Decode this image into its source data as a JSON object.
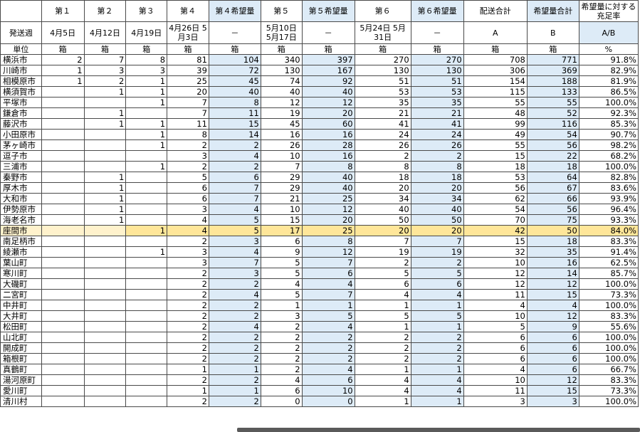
{
  "header_row1": [
    "",
    "第１",
    "第２",
    "第３",
    "第４",
    "第４希望量",
    "第５",
    "第５希望量",
    "第６",
    "第６希望量",
    "配送合計",
    "希望量合計",
    "希望量に対する充足率"
  ],
  "header_row2": [
    "発送週",
    "4月5日",
    "4月12日",
    "4月19日",
    "4月26日\n5月3日",
    "－",
    "5月10日\n5月17日",
    "－",
    "5月24日\n5月31日",
    "－",
    "A",
    "B",
    "A/B"
  ],
  "header_row3": [
    "単位",
    "箱",
    "箱",
    "箱",
    "箱",
    "箱",
    "箱",
    "箱",
    "箱",
    "箱",
    "箱",
    "箱",
    "%"
  ],
  "rows": [
    [
      "横浜市",
      "2",
      "7",
      "8",
      "81",
      "104",
      "340",
      "397",
      "270",
      "270",
      "708",
      "771",
      "91.8%"
    ],
    [
      "川崎市",
      "1",
      "3",
      "3",
      "39",
      "72",
      "130",
      "167",
      "130",
      "130",
      "306",
      "369",
      "82.9%"
    ],
    [
      "相模原市",
      "1",
      "2",
      "1",
      "25",
      "45",
      "74",
      "92",
      "51",
      "51",
      "154",
      "188",
      "81.9%"
    ],
    [
      "横須賀市",
      "",
      "1",
      "1",
      "20",
      "40",
      "40",
      "40",
      "53",
      "53",
      "115",
      "133",
      "86.5%"
    ],
    [
      "平塚市",
      "",
      "",
      "1",
      "7",
      "8",
      "12",
      "12",
      "35",
      "35",
      "55",
      "55",
      "100.0%"
    ],
    [
      "鎌倉市",
      "",
      "1",
      "",
      "7",
      "11",
      "19",
      "20",
      "21",
      "21",
      "48",
      "52",
      "92.3%"
    ],
    [
      "藤沢市",
      "",
      "1",
      "1",
      "11",
      "15",
      "45",
      "60",
      "41",
      "41",
      "99",
      "116",
      "85.3%"
    ],
    [
      "小田原市",
      "",
      "",
      "1",
      "8",
      "14",
      "16",
      "16",
      "24",
      "24",
      "49",
      "54",
      "90.7%"
    ],
    [
      "茅ヶ崎市",
      "",
      "",
      "1",
      "2",
      "2",
      "26",
      "28",
      "26",
      "26",
      "55",
      "56",
      "98.2%"
    ],
    [
      "逗子市",
      "",
      "",
      "",
      "3",
      "4",
      "10",
      "16",
      "2",
      "2",
      "15",
      "22",
      "68.2%"
    ],
    [
      "三浦市",
      "",
      "",
      "1",
      "2",
      "2",
      "7",
      "8",
      "8",
      "8",
      "18",
      "18",
      "100.0%"
    ],
    [
      "秦野市",
      "",
      "1",
      "",
      "5",
      "6",
      "29",
      "40",
      "18",
      "18",
      "53",
      "64",
      "82.8%"
    ],
    [
      "厚木市",
      "",
      "1",
      "",
      "6",
      "7",
      "29",
      "40",
      "20",
      "20",
      "56",
      "67",
      "83.6%"
    ],
    [
      "大和市",
      "",
      "1",
      "",
      "6",
      "7",
      "21",
      "25",
      "34",
      "34",
      "62",
      "66",
      "93.9%"
    ],
    [
      "伊勢原市",
      "",
      "1",
      "",
      "3",
      "4",
      "10",
      "12",
      "40",
      "40",
      "54",
      "56",
      "96.4%"
    ],
    [
      "海老名市",
      "",
      "1",
      "",
      "4",
      "5",
      "15",
      "20",
      "50",
      "50",
      "70",
      "75",
      "93.3%"
    ],
    [
      "座間市",
      "",
      "",
      "1",
      "4",
      "5",
      "17",
      "25",
      "20",
      "20",
      "42",
      "50",
      "84.0%"
    ],
    [
      "南足柄市",
      "",
      "",
      "",
      "2",
      "3",
      "6",
      "8",
      "7",
      "7",
      "15",
      "18",
      "83.3%"
    ],
    [
      "綾瀬市",
      "",
      "",
      "1",
      "3",
      "4",
      "9",
      "12",
      "19",
      "19",
      "32",
      "35",
      "91.4%"
    ],
    [
      "葉山町",
      "",
      "",
      "",
      "3",
      "7",
      "5",
      "7",
      "2",
      "2",
      "10",
      "16",
      "62.5%"
    ],
    [
      "寒川町",
      "",
      "",
      "",
      "2",
      "3",
      "5",
      "6",
      "5",
      "5",
      "12",
      "14",
      "85.7%"
    ],
    [
      "大磯町",
      "",
      "",
      "",
      "2",
      "2",
      "4",
      "4",
      "6",
      "6",
      "12",
      "12",
      "100.0%"
    ],
    [
      "二宮町",
      "",
      "",
      "",
      "2",
      "4",
      "5",
      "7",
      "4",
      "4",
      "11",
      "15",
      "73.3%"
    ],
    [
      "中井町",
      "",
      "",
      "",
      "2",
      "2",
      "1",
      "1",
      "1",
      "1",
      "4",
      "4",
      "100.0%"
    ],
    [
      "大井町",
      "",
      "",
      "",
      "2",
      "2",
      "3",
      "5",
      "5",
      "5",
      "10",
      "12",
      "83.3%"
    ],
    [
      "松田町",
      "",
      "",
      "",
      "2",
      "4",
      "2",
      "4",
      "1",
      "1",
      "5",
      "9",
      "55.6%"
    ],
    [
      "山北町",
      "",
      "",
      "",
      "2",
      "2",
      "2",
      "2",
      "2",
      "2",
      "6",
      "6",
      "100.0%"
    ],
    [
      "開成町",
      "",
      "",
      "",
      "2",
      "2",
      "2",
      "2",
      "2",
      "2",
      "6",
      "6",
      "100.0%"
    ],
    [
      "箱根町",
      "",
      "",
      "",
      "2",
      "2",
      "2",
      "2",
      "2",
      "2",
      "6",
      "6",
      "100.0%"
    ],
    [
      "真鶴町",
      "",
      "",
      "",
      "1",
      "1",
      "2",
      "4",
      "1",
      "1",
      "4",
      "6",
      "66.7%"
    ],
    [
      "湯河原町",
      "",
      "",
      "",
      "2",
      "2",
      "4",
      "6",
      "4",
      "4",
      "10",
      "12",
      "83.3%"
    ],
    [
      "愛川町",
      "",
      "",
      "",
      "1",
      "1",
      "6",
      "10",
      "4",
      "4",
      "11",
      "15",
      "73.3%"
    ],
    [
      "清川村",
      "",
      "",
      "",
      "2",
      "2",
      "0",
      "0",
      "1",
      "1",
      "3",
      "3",
      "100.0%"
    ]
  ],
  "highlight_row": "座間市",
  "colors": {
    "shade": "#ddebf7",
    "highlight": "#fff2cc",
    "highlight_cell": "#ffe699",
    "border": "#4a4a4a"
  }
}
